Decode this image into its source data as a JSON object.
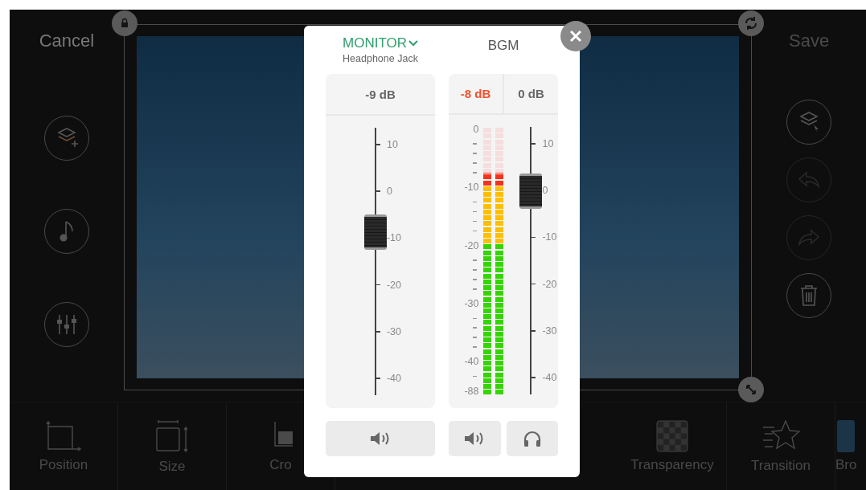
{
  "top_bar": {
    "cancel": "Cancel",
    "save": "Save",
    "save_disabled": true
  },
  "left_tools": [
    {
      "kind": "add-layer"
    },
    {
      "kind": "music"
    },
    {
      "kind": "mixer"
    }
  ],
  "right_tools": [
    {
      "kind": "layers",
      "disabled": false
    },
    {
      "kind": "undo",
      "disabled": true
    },
    {
      "kind": "redo",
      "disabled": true
    },
    {
      "kind": "delete",
      "disabled": false
    }
  ],
  "toolbar": {
    "left": [
      {
        "kind": "position",
        "label": "Position"
      },
      {
        "kind": "size",
        "label": "Size"
      },
      {
        "kind": "crop",
        "label": "Cro"
      }
    ],
    "right": [
      {
        "kind": "transparency",
        "label": "Transparency"
      },
      {
        "kind": "transition",
        "label": "Transition"
      },
      {
        "kind": "browse",
        "label": "Bro"
      }
    ]
  },
  "mixer": {
    "monitor": {
      "title": "MONITOR",
      "subtitle": "Headphone Jack",
      "reading": "-9 dB",
      "level": 0.61,
      "scale": [
        "10",
        "0",
        "-10",
        "-20",
        "-30",
        "-40"
      ]
    },
    "bgm": {
      "title": "BGM",
      "meter_reading": "-8 dB",
      "reading": "0 dB",
      "meter": {
        "level": 0.83,
        "scale": [
          "0",
          "-10",
          "-20",
          "-30",
          "-40",
          "-88"
        ]
      },
      "level": 0.76,
      "scale": [
        "10",
        "0",
        "-10",
        "-20",
        "-30",
        "-40"
      ]
    }
  }
}
